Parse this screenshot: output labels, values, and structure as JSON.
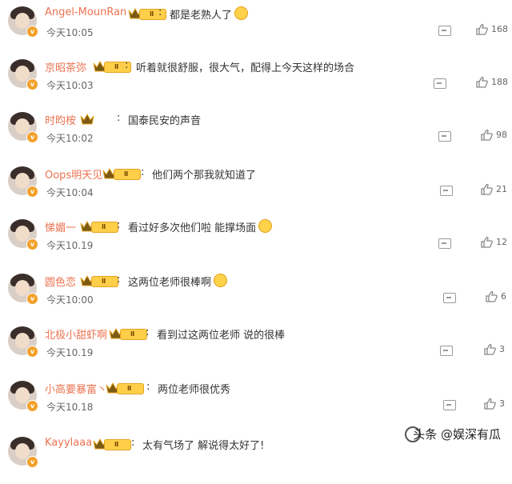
{
  "comments": [
    {
      "name": "Angel-MounRan",
      "text": "都是老熟人了",
      "emoji": true,
      "time": "今天10:05",
      "likes": "168",
      "level": "Ⅱ"
    },
    {
      "name": "京昭茶弥",
      "text": "听着就很舒服，很大气，配得上今天这样的场合",
      "emoji": false,
      "time": "今天10:03",
      "likes": "188",
      "level": "Ⅱ"
    },
    {
      "name": "时昀桉",
      "text": "国泰民安的声音",
      "emoji": false,
      "time": "今天10:02",
      "likes": "98",
      "level": ""
    },
    {
      "name": "Oops明天见",
      "text": "他们两个那我就知道了",
      "emoji": false,
      "time": "今天10:04",
      "likes": "21",
      "level": "Ⅱ"
    },
    {
      "name": "悌媚一",
      "text": "看过好多次他们啦 能撑场面",
      "emoji": true,
      "time": "今天10.19",
      "likes": "12",
      "level": "Ⅱ"
    },
    {
      "name": "圆色恋",
      "text": "这两位老师很棒啊",
      "emoji": true,
      "time": "今天10:00",
      "likes": "6",
      "level": "Ⅱ"
    },
    {
      "name": "北极小甜虾啊",
      "text": "看到过这两位老师 说的很棒",
      "emoji": false,
      "time": "今天10.19",
      "likes": "3",
      "level": "Ⅱ"
    },
    {
      "name": "小高要暴富丶",
      "text": "两位老师很优秀",
      "emoji": false,
      "time": "今天10.18",
      "likes": "3",
      "level": "Ⅱ"
    },
    {
      "name": "Kayylaaa",
      "text": "太有气场了 解说得太好了!",
      "emoji": false,
      "time": "",
      "likes": "",
      "level": "Ⅱ"
    }
  ],
  "watermark": "头条 @娱深有瓜",
  "colors": {
    "name": "#eb7350",
    "text": "#333333",
    "meta": "#666666",
    "badge": "#ffcf4a"
  }
}
